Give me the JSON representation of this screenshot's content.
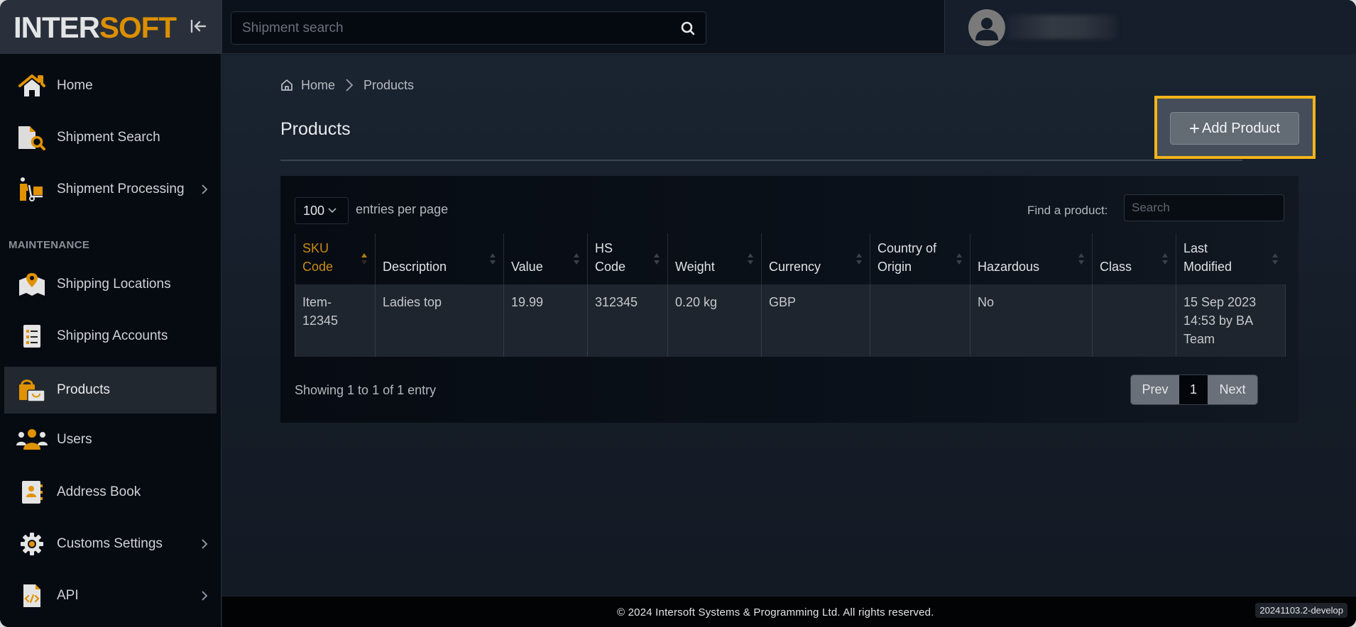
{
  "brand": {
    "logo_part1": "INTER",
    "logo_part2": "SOFT",
    "accent_color": "#db8f00"
  },
  "topbar": {
    "search_placeholder": "Shipment search",
    "search_icon": "search-icon",
    "user_avatar_icon": "user-avatar-icon"
  },
  "sidebar": {
    "items": [
      {
        "label": "Home",
        "icon": "home-icon",
        "has_submenu": false,
        "active": false
      },
      {
        "label": "Shipment Search",
        "icon": "document-search-icon",
        "has_submenu": false,
        "active": false
      },
      {
        "label": "Shipment Processing",
        "icon": "person-dolly-icon",
        "has_submenu": true,
        "active": false
      },
      {
        "label": "Shipping Locations",
        "icon": "map-pin-icon",
        "has_submenu": false,
        "active": false
      },
      {
        "label": "Shipping Accounts",
        "icon": "list-icon",
        "has_submenu": false,
        "active": false
      },
      {
        "label": "Products",
        "icon": "shopping-bags-icon",
        "has_submenu": false,
        "active": true
      },
      {
        "label": "Users",
        "icon": "users-icon",
        "has_submenu": false,
        "active": false
      },
      {
        "label": "Address Book",
        "icon": "address-book-icon",
        "has_submenu": false,
        "active": false
      },
      {
        "label": "Customs Settings",
        "icon": "gear-icon",
        "has_submenu": true,
        "active": false
      },
      {
        "label": "API",
        "icon": "code-file-icon",
        "has_submenu": true,
        "active": false
      }
    ],
    "section_maintenance": "MAINTENANCE"
  },
  "breadcrumb": {
    "home": "Home",
    "current": "Products"
  },
  "page": {
    "title": "Products",
    "add_button": "Add Product",
    "highlight_color": "#f4b41a"
  },
  "table_controls": {
    "page_length": "100",
    "entries_label": "entries per page",
    "find_label": "Find a product:",
    "find_placeholder": "Search"
  },
  "table": {
    "columns": [
      {
        "label": "SKU Code",
        "sorted": "asc"
      },
      {
        "label": "Description",
        "sorted": null
      },
      {
        "label": "Value",
        "sorted": null
      },
      {
        "label": "HS Code",
        "sorted": null
      },
      {
        "label": "Weight",
        "sorted": null
      },
      {
        "label": "Currency",
        "sorted": null
      },
      {
        "label": "Country of Origin",
        "sorted": null
      },
      {
        "label": "Hazardous",
        "sorted": null
      },
      {
        "label": "Class",
        "sorted": null
      },
      {
        "label": "Last Modified",
        "sorted": null
      }
    ],
    "rows": [
      {
        "sku": "Item-12345",
        "description": "Ladies top",
        "value": "19.99",
        "hs_code": "312345",
        "weight": "0.20 kg",
        "currency": "GBP",
        "country_of_origin": "",
        "hazardous": "No",
        "class": "",
        "last_modified": "15 Sep 2023 14:53 by BA Team"
      }
    ]
  },
  "pagination": {
    "info": "Showing 1 to 1 of 1 entry",
    "prev": "Prev",
    "current": "1",
    "next": "Next"
  },
  "footer": {
    "copyright": "© 2024 Intersoft Systems & Programming Ltd. All rights reserved.",
    "version": "20241103.2-develop"
  }
}
